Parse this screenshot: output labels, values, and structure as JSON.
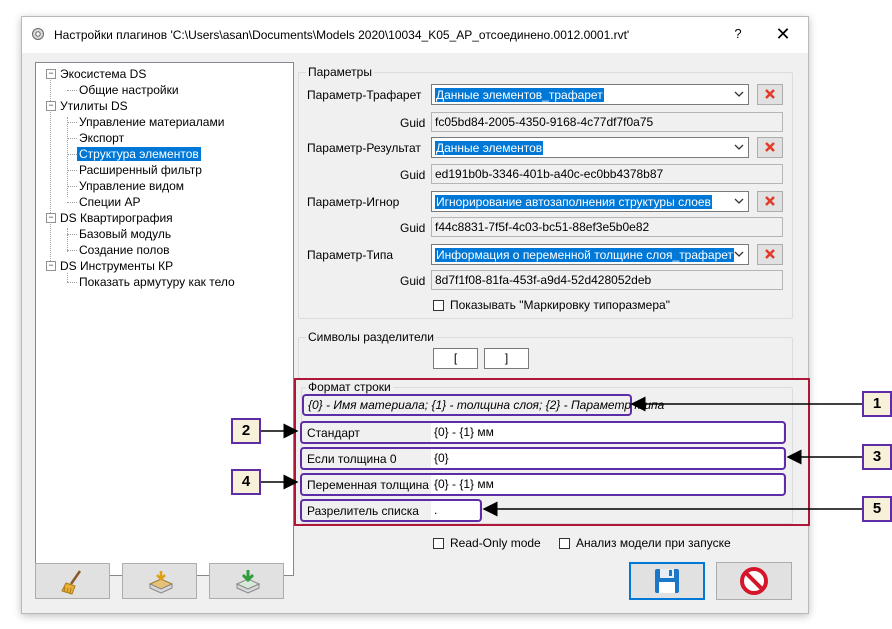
{
  "window": {
    "title": "Настройки плагинов 'C:\\Users\\asan\\Documents\\Models 2020\\10034_K05_AP_отсоединено.0012.0001.rvt'",
    "help_label": "?",
    "close_label": "✕"
  },
  "tree": {
    "nodes": [
      {
        "label": "Экосистема DS"
      },
      {
        "label": "Общие настройки"
      },
      {
        "label": "Утилиты DS"
      },
      {
        "label": "Управление материалами"
      },
      {
        "label": "Экспорт"
      },
      {
        "label": "Структура элементов"
      },
      {
        "label": "Расширенный фильтр"
      },
      {
        "label": "Управление видом"
      },
      {
        "label": "Специи АР"
      },
      {
        "label": "DS Квартирография"
      },
      {
        "label": "Базовый модуль"
      },
      {
        "label": "Создание полов"
      },
      {
        "label": "DS Инструменты КР"
      },
      {
        "label": "Показать армутуру как тело"
      }
    ],
    "expander_symbol": "−"
  },
  "params": {
    "title": "Параметры",
    "guid_label": "Guid",
    "rows": [
      {
        "label": "Параметр-Трафарет",
        "value": "Данные элементов_трафарет",
        "guid": "fc05bd84-2005-4350-9168-4c77df7f0a75"
      },
      {
        "label": "Параметр-Результат",
        "value": "Данные элементов",
        "guid": "ed191b0b-3346-401b-a40c-ec0bb4378b87"
      },
      {
        "label": "Параметр-Игнор",
        "value": "Игнорирование автозаполнения структуры слоев",
        "guid": "f44c8831-7f5f-4c03-bc51-88ef3e5b0e82"
      },
      {
        "label": "Параметр-Типа",
        "value": "Информация о переменной толщине слоя_трафарет",
        "guid": "8d7f1f08-81fa-453f-a9d4-52d428052deb"
      }
    ],
    "show_marking_label": "Показывать \"Маркировку типоразмера\""
  },
  "separators": {
    "title": "Символы разделители",
    "open": "[",
    "close": "]"
  },
  "format": {
    "title": "Формат строки",
    "hint": "{0} - Имя материала; {1} - толщина слоя; {2} - Параметр типа",
    "rows": [
      {
        "label": "Стандарт",
        "value": "{0} - {1} мм"
      },
      {
        "label": "Если толщина 0",
        "value": "{0}"
      },
      {
        "label": "Переменная толщина",
        "value": "{0} - {1} мм"
      },
      {
        "label": "Разрелитель списка",
        "value": "."
      }
    ]
  },
  "options": {
    "readonly_label": "Read-Only mode",
    "analyze_label": "Анализ модели при запуске"
  },
  "callouts": [
    "1",
    "2",
    "3",
    "4",
    "5"
  ],
  "colors": {
    "accent": "#0078d7",
    "annotation_box": "#5e2ca5",
    "highlight_frame": "#b0163a",
    "callout_fill": "#f8f1d9"
  },
  "icons": [
    "app-gear-icon",
    "broom-icon",
    "import-icon",
    "export-download-icon",
    "save-floppy-icon",
    "cancel-no-icon",
    "delete-x-icon",
    "dropdown-arrow-icon"
  ]
}
